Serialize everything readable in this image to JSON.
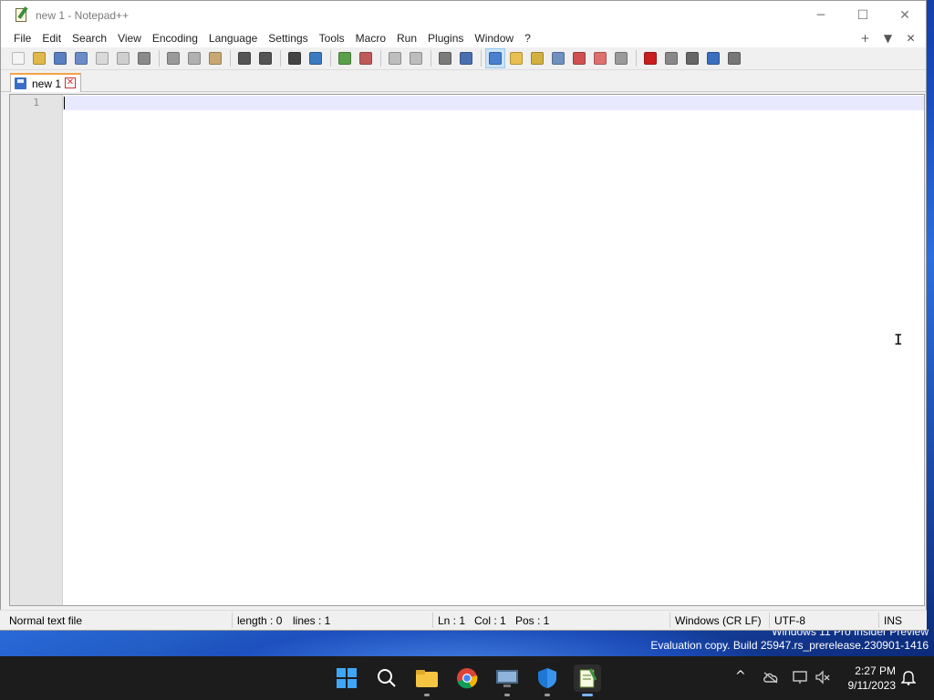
{
  "window": {
    "title": "new 1 - Notepad++",
    "controls": {
      "minimize": "─",
      "maximize": "☐",
      "close": "✕"
    }
  },
  "menubar": {
    "items": [
      "File",
      "Edit",
      "Search",
      "View",
      "Encoding",
      "Language",
      "Settings",
      "Tools",
      "Macro",
      "Run",
      "Plugins",
      "Window",
      "?"
    ],
    "right": {
      "add": "+",
      "dropdown": "▼",
      "close": "✕"
    }
  },
  "toolbar": {
    "buttons": [
      {
        "name": "new-file-icon",
        "color": "#f4f4f4"
      },
      {
        "name": "open-file-icon",
        "color": "#e0b84a"
      },
      {
        "name": "save-icon",
        "color": "#5a7fc0"
      },
      {
        "name": "save-all-icon",
        "color": "#6b8cc8"
      },
      {
        "name": "close-file-icon",
        "color": "#d9d9d9"
      },
      {
        "name": "close-all-icon",
        "color": "#cfcfcf"
      },
      {
        "name": "print-icon",
        "color": "#8a8a8a"
      },
      {
        "name": "cut-icon",
        "color": "#9a9a9a"
      },
      {
        "name": "copy-icon",
        "color": "#b0b0b0"
      },
      {
        "name": "paste-icon",
        "color": "#c8a870"
      },
      {
        "name": "undo-icon",
        "color": "#555555"
      },
      {
        "name": "redo-icon",
        "color": "#555555"
      },
      {
        "name": "find-icon",
        "color": "#444444"
      },
      {
        "name": "replace-icon",
        "color": "#3a7ac0"
      },
      {
        "name": "zoom-in-icon",
        "color": "#5aa04a"
      },
      {
        "name": "zoom-out-icon",
        "color": "#c05a5a"
      },
      {
        "name": "sync-vertical-icon",
        "color": "#bdbdbd"
      },
      {
        "name": "sync-horizontal-icon",
        "color": "#bdbdbd"
      },
      {
        "name": "word-wrap-icon",
        "color": "#7a7a7a"
      },
      {
        "name": "show-all-chars-icon",
        "color": "#4a6fb0"
      },
      {
        "name": "indent-guide-icon",
        "color": "#4a80d0",
        "active": true
      },
      {
        "name": "user-language-icon",
        "color": "#e8c050"
      },
      {
        "name": "document-map-icon",
        "color": "#d4b040"
      },
      {
        "name": "function-list-icon",
        "color": "#7090c0"
      },
      {
        "name": "folder-workspace-icon",
        "color": "#d05050"
      },
      {
        "name": "monitoring-icon",
        "color": "#e07070"
      },
      {
        "name": "plugin-icon",
        "color": "#9a9a9a"
      },
      {
        "name": "macro-record-icon",
        "color": "#c81e1e"
      },
      {
        "name": "macro-stop-icon",
        "color": "#888888"
      },
      {
        "name": "macro-play-icon",
        "color": "#666666"
      },
      {
        "name": "macro-play-multiple-icon",
        "color": "#3a6fc0"
      },
      {
        "name": "macro-save-icon",
        "color": "#777777"
      }
    ]
  },
  "tab": {
    "label": "new 1",
    "close": "✕"
  },
  "editor": {
    "line_number": "1"
  },
  "statusbar": {
    "file_type": "Normal text file",
    "length": "length : 0",
    "lines": "lines : 1",
    "ln": "Ln : 1",
    "col": "Col : 1",
    "pos": "Pos : 1",
    "eol": "Windows (CR LF)",
    "encoding": "UTF-8",
    "mode": "INS"
  },
  "desktop": {
    "watermark_line1": "Windows 11 Pro Insider Preview",
    "watermark_line2": "Evaluation copy. Build 25947.rs_prerelease.230901-1416"
  },
  "taskbar": {
    "time": "2:27 PM",
    "date": "9/11/2023",
    "tray_chevron": "^"
  }
}
